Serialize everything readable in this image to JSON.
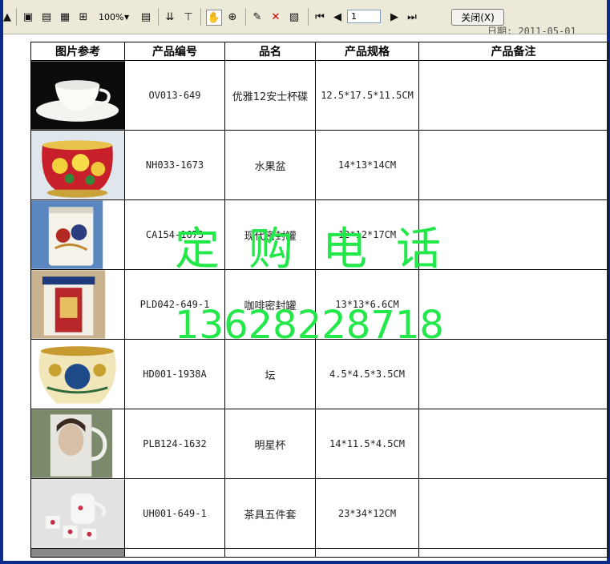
{
  "toolbar": {
    "zoom": "100%",
    "page_number": "1",
    "close_label": "关闭(X)"
  },
  "report": {
    "date_text": "日期: 2011-05-01",
    "headers": [
      "图片参考",
      "产品编号",
      "品名",
      "产品规格",
      "产品备注"
    ],
    "rows": [
      {
        "code": "OV013-649",
        "name": "优雅12安士杯碟",
        "spec": "12.5*17.5*11.5CM",
        "note": ""
      },
      {
        "code": "NH033-1673",
        "name": "水果盆",
        "spec": "14*13*14CM",
        "note": ""
      },
      {
        "code": "CA154-1673",
        "name": "现代密封罐",
        "spec": "12*12*17CM",
        "note": ""
      },
      {
        "code": "PLD042-649-1",
        "name": "咖啡密封罐",
        "spec": "13*13*6.6CM",
        "note": ""
      },
      {
        "code": "HD001-1938A",
        "name": "坛",
        "spec": "4.5*4.5*3.5CM",
        "note": ""
      },
      {
        "code": "PLB124-1632",
        "name": "明星杯",
        "spec": "14*11.5*4.5CM",
        "note": ""
      },
      {
        "code": "UH001-649-1",
        "name": "茶具五件套",
        "spec": "23*34*12CM",
        "note": ""
      }
    ]
  },
  "watermark": {
    "line1": "定购电话",
    "line2": "13628228718",
    "color": "#22e84a"
  },
  "icons": [
    "print-icon",
    "single-page-icon",
    "facing-pages-icon",
    "multi-page-icon",
    "layout-icon",
    "export-icon",
    "tree-icon",
    "hand-icon",
    "zoom-in-icon",
    "insert-icon",
    "delete-icon",
    "setup-icon",
    "first-page-icon",
    "prev-page-icon",
    "next-page-icon",
    "last-page-icon"
  ]
}
